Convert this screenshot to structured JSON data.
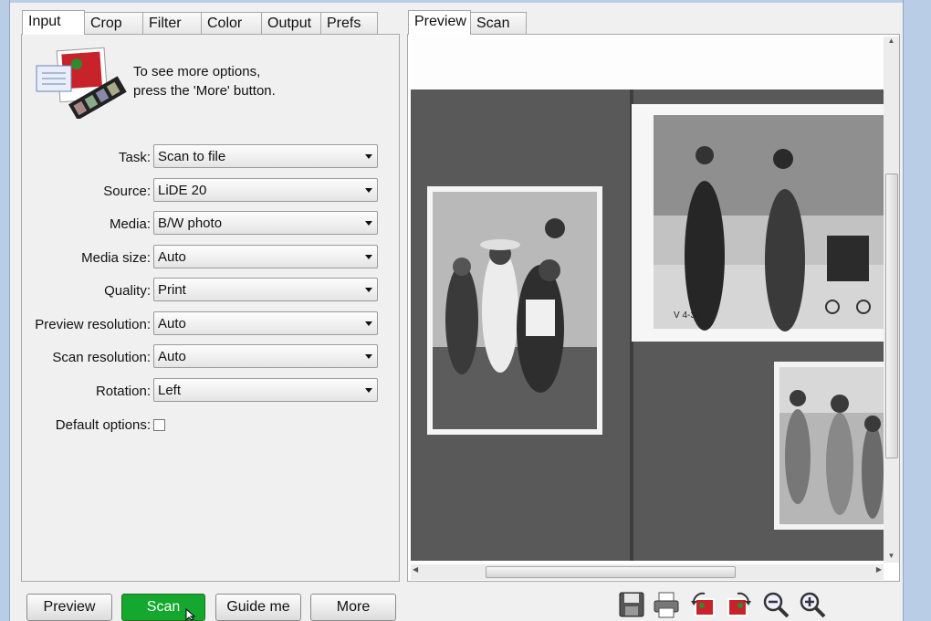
{
  "tabs_left": [
    {
      "label": "Input"
    },
    {
      "label": "Crop"
    },
    {
      "label": "Filter"
    },
    {
      "label": "Color"
    },
    {
      "label": "Output"
    },
    {
      "label": "Prefs"
    }
  ],
  "tabs_right": [
    {
      "label": "Preview"
    },
    {
      "label": "Scan"
    }
  ],
  "info": {
    "line1": "To see more options,",
    "line2": "press the 'More' button."
  },
  "options": [
    {
      "label": "Task:",
      "value": "Scan to file"
    },
    {
      "label": "Source:",
      "value": "LiDE 20"
    },
    {
      "label": "Media:",
      "value": "B/W photo"
    },
    {
      "label": "Media size:",
      "value": "Auto"
    },
    {
      "label": "Quality:",
      "value": "Print"
    },
    {
      "label": "Preview resolution:",
      "value": "Auto"
    },
    {
      "label": "Scan resolution:",
      "value": "Auto"
    },
    {
      "label": "Rotation:",
      "value": "Left"
    }
  ],
  "default_options": {
    "label": "Default options:",
    "checked": false
  },
  "preview_marks": {
    "print_code": "V 4-32"
  },
  "buttons": {
    "preview": "Preview",
    "scan": "Scan",
    "guide": "Guide me",
    "more": "More"
  },
  "toolbar_icons": [
    "save-icon",
    "print-icon",
    "rotate-left-icon",
    "rotate-right-icon",
    "zoom-out-icon",
    "zoom-in-icon"
  ],
  "colors": {
    "scan_button": "#14a82e",
    "window_frame": "#b9cde6"
  }
}
